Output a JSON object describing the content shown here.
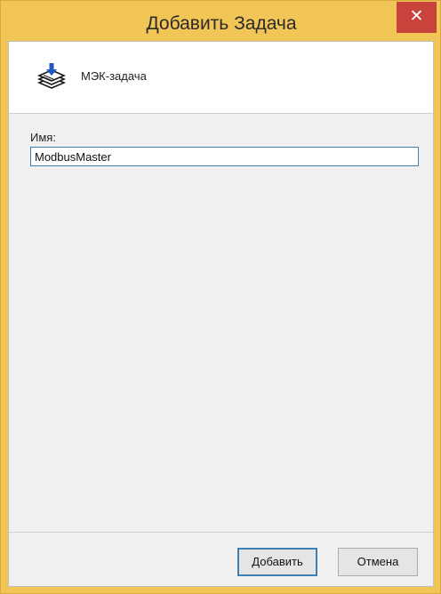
{
  "window": {
    "title": "Добавить Задача",
    "close_symbol": "✕"
  },
  "header": {
    "icon": "stack-download-icon",
    "task_type_label": "МЭК-задача"
  },
  "form": {
    "name_label": "Имя:",
    "name_value": "ModbusMaster"
  },
  "buttons": {
    "add_label": "Добавить",
    "cancel_label": "Отмена"
  },
  "colors": {
    "titlebar": "#f2c557",
    "close_button": "#c7433c",
    "input_border": "#3c7fb1"
  }
}
